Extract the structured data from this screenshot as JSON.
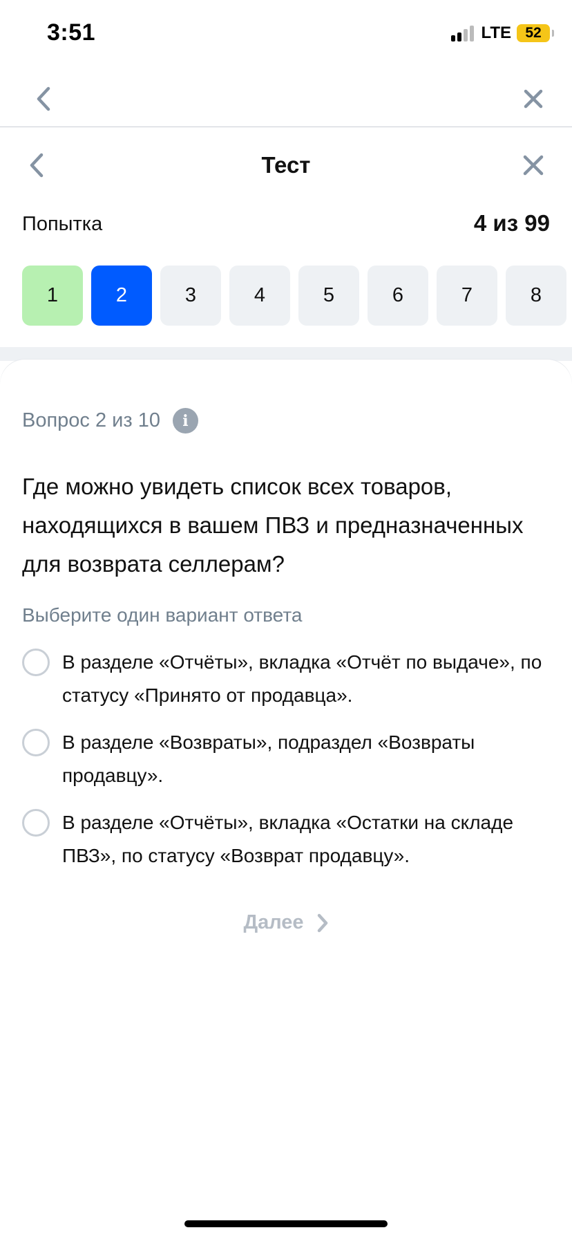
{
  "status_bar": {
    "time": "3:51",
    "network": "LTE",
    "battery": "52"
  },
  "header": {
    "title": "Тест",
    "attempt_label": "Попытка",
    "attempt_value": "4 из 99"
  },
  "steps": [
    "1",
    "2",
    "3",
    "4",
    "5",
    "6",
    "7",
    "8"
  ],
  "question": {
    "counter": "Вопрос 2 из 10",
    "text": "Где можно увидеть список всех товаров, находящихся в вашем ПВЗ и предназначенных для возврата селлерам?",
    "hint": "Выберите один вариант ответа",
    "options": [
      "В разделе «Отчёты», вкладка «Отчёт по выдаче», по статусу «Принято от продавца».",
      "В разделе «Возвраты», подраздел «Возвраты продавцу».",
      "В разделе «Отчёты», вкладка «Остатки на складе ПВЗ», по статусу «Возврат продавцу»."
    ]
  },
  "footer": {
    "next_label": "Далее"
  },
  "colors": {
    "accent": "#005bff",
    "done": "#b7f0b1",
    "inactive_step": "#eef1f4",
    "muted_text": "#707f8d",
    "disabled": "#b5bcc5"
  },
  "icons": {
    "back": "chevron-left-icon",
    "close": "close-icon",
    "info": "info-icon",
    "next": "chevron-right-icon"
  }
}
